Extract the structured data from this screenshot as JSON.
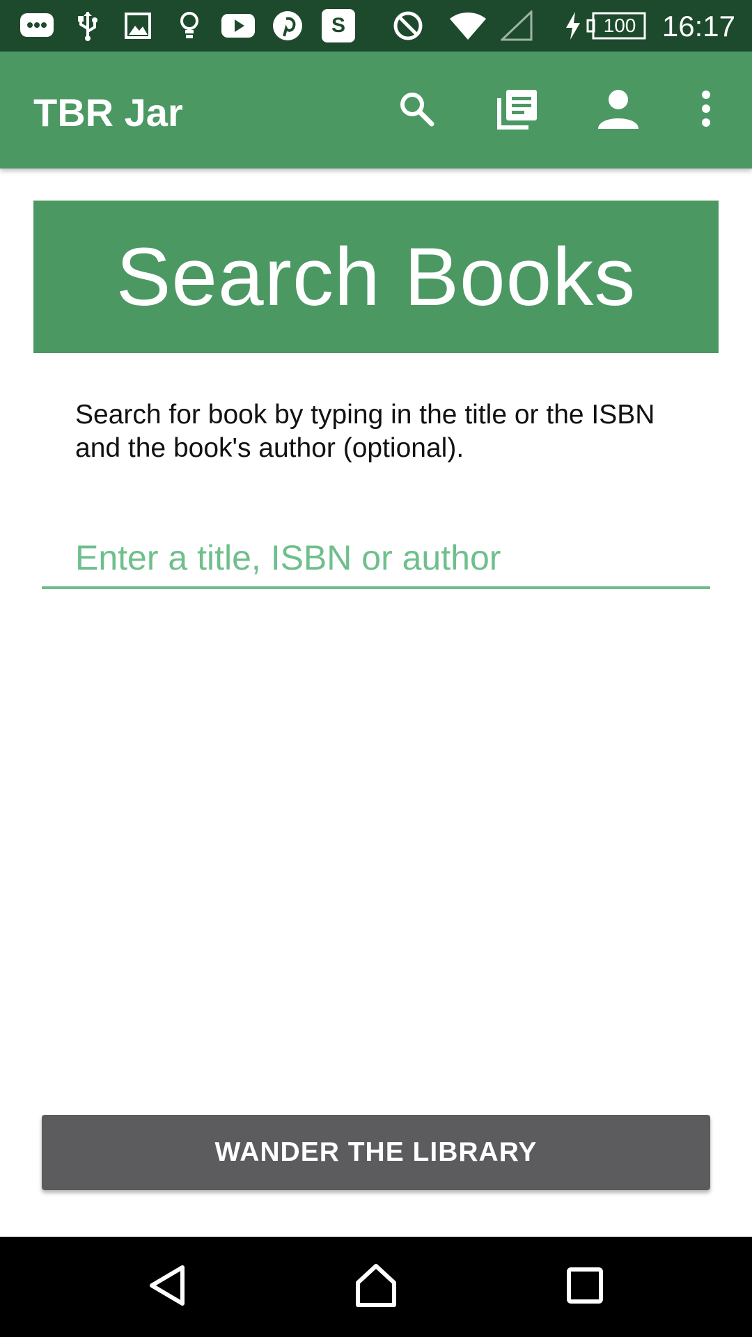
{
  "status_bar": {
    "time": "16:17",
    "battery_level": "100",
    "icons": [
      "messages-icon",
      "usb-icon",
      "image-icon",
      "lightbulb-icon",
      "youtube-icon",
      "pinterest-icon",
      "s-app-icon",
      "do-not-disturb-icon",
      "wifi-icon",
      "cell-signal-icon",
      "charging-icon",
      "battery-icon"
    ],
    "s_app_letter": "S"
  },
  "app_bar": {
    "title": "TBR Jar",
    "actions": [
      "search-icon",
      "library-icon",
      "account-icon",
      "overflow-menu-icon"
    ]
  },
  "banner": {
    "title": "Search Books"
  },
  "instructions": "Search for book by typing in the title or the ISBN and the book's author (optional).",
  "search": {
    "placeholder": "Enter a title, ISBN or author",
    "value": ""
  },
  "wander_button": {
    "label": "WANDER THE LIBRARY"
  },
  "nav_bar": {
    "buttons": [
      "back-icon",
      "home-icon",
      "recents-icon"
    ]
  },
  "colors": {
    "status_bar": "#1d4a2c",
    "primary": "#4b9863",
    "accent": "#6fbb8a",
    "button": "#5c5c5e",
    "nav_bar": "#000000"
  }
}
